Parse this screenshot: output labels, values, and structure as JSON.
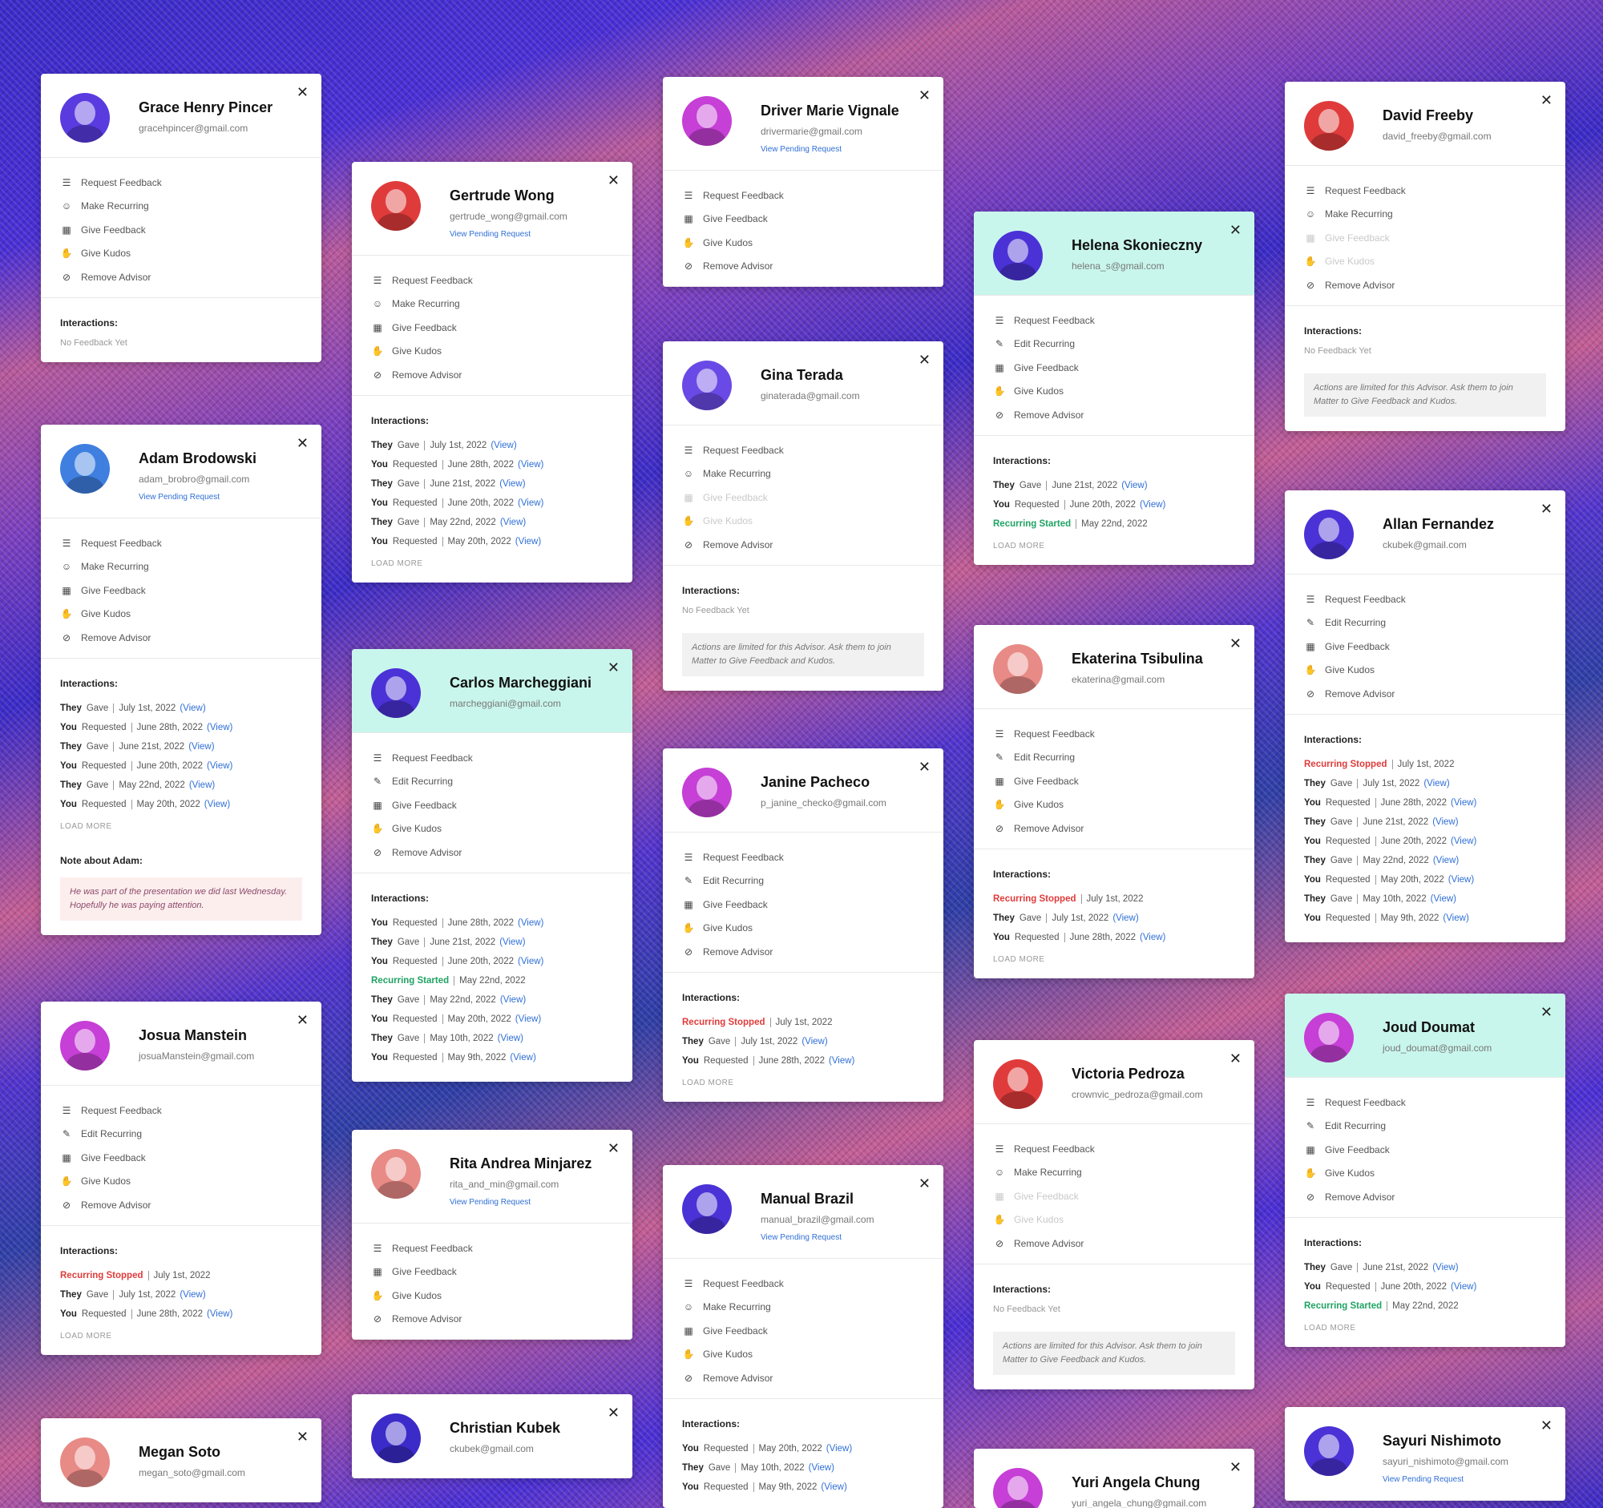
{
  "labels": {
    "request_feedback": "Request Feedback",
    "make_recurring": "Make Recurring",
    "edit_recurring": "Edit Recurring",
    "give_feedback": "Give Feedback",
    "give_kudos": "Give Kudos",
    "remove_advisor": "Remove Advisor",
    "interactions": "Interactions:",
    "no_feedback": "No Feedback Yet",
    "load_more": "LOAD MORE",
    "view_pending": "View Pending Request",
    "view": "(View)",
    "limited_notice": "Actions are limited for this Advisor. Ask them to join Matter to Give Feedback and Kudos.",
    "close": "✕"
  },
  "cards": [
    {
      "name": "Grace Henry Pincer",
      "email": "gracehpincer@gmail.com",
      "avatar_color": "#5a3be0",
      "highlight": false,
      "pending": false,
      "actions": [
        {
          "k": "request_feedback"
        },
        {
          "k": "make_recurring"
        },
        {
          "k": "give_feedback"
        },
        {
          "k": "give_kudos"
        },
        {
          "k": "remove_advisor"
        }
      ],
      "no_feedback": true,
      "interactions": [],
      "load_more": false,
      "notice": false
    },
    {
      "name": "Adam Brodowski",
      "email": "adam_brobro@gmail.com",
      "avatar_color": "#3f7fe0",
      "highlight": false,
      "pending": true,
      "actions": [
        {
          "k": "request_feedback"
        },
        {
          "k": "make_recurring"
        },
        {
          "k": "give_feedback"
        },
        {
          "k": "give_kudos"
        },
        {
          "k": "remove_advisor"
        }
      ],
      "no_feedback": false,
      "interactions": [
        {
          "who": "They",
          "what": "Gave",
          "date": "July 1st, 2022",
          "view": true
        },
        {
          "who": "You",
          "what": "Requested",
          "date": "June 28th, 2022",
          "view": true
        },
        {
          "who": "They",
          "what": "Gave",
          "date": "June 21st, 2022",
          "view": true
        },
        {
          "who": "You",
          "what": "Requested",
          "date": "June 20th, 2022",
          "view": true
        },
        {
          "who": "They",
          "what": "Gave",
          "date": "May 22nd, 2022",
          "view": true
        },
        {
          "who": "You",
          "what": "Requested",
          "date": "May 20th, 2022",
          "view": true
        }
      ],
      "load_more": true,
      "notice": false,
      "note_title": "Note about Adam:",
      "note": "He was part of the presentation we did last Wednesday. Hopefully he was paying attention."
    },
    {
      "name": "Josua Manstein",
      "email": "josuaManstein@gmail.com",
      "avatar_color": "#c63fd6",
      "highlight": false,
      "pending": false,
      "actions": [
        {
          "k": "request_feedback"
        },
        {
          "k": "edit_recurring"
        },
        {
          "k": "give_feedback"
        },
        {
          "k": "give_kudos"
        },
        {
          "k": "remove_advisor"
        }
      ],
      "no_feedback": false,
      "interactions": [
        {
          "status": "Recurring Stopped",
          "tone": "red",
          "date": "July 1st, 2022",
          "view": false
        },
        {
          "who": "They",
          "what": "Gave",
          "date": "July 1st, 2022",
          "view": true
        },
        {
          "who": "You",
          "what": "Requested",
          "date": "June 28th, 2022",
          "view": true
        }
      ],
      "load_more": true,
      "notice": false
    },
    {
      "name": "Megan Soto",
      "email": "megan_soto@gmail.com",
      "avatar_color": "#e88a86",
      "highlight": false,
      "pending": false,
      "actions": [],
      "no_feedback": false,
      "interactions": [],
      "load_more": false,
      "notice": false
    },
    {
      "name": "Gertrude Wong",
      "email": "gertrude_wong@gmail.com",
      "avatar_color": "#e03b3b",
      "highlight": false,
      "pending": true,
      "actions": [
        {
          "k": "request_feedback"
        },
        {
          "k": "make_recurring"
        },
        {
          "k": "give_feedback"
        },
        {
          "k": "give_kudos"
        },
        {
          "k": "remove_advisor"
        }
      ],
      "no_feedback": false,
      "interactions": [
        {
          "who": "They",
          "what": "Gave",
          "date": "July 1st, 2022",
          "view": true
        },
        {
          "who": "You",
          "what": "Requested",
          "date": "June 28th, 2022",
          "view": true
        },
        {
          "who": "They",
          "what": "Gave",
          "date": "June 21st, 2022",
          "view": true
        },
        {
          "who": "You",
          "what": "Requested",
          "date": "June 20th, 2022",
          "view": true
        },
        {
          "who": "They",
          "what": "Gave",
          "date": "May 22nd, 2022",
          "view": true
        },
        {
          "who": "You",
          "what": "Requested",
          "date": "May 20th, 2022",
          "view": true
        }
      ],
      "load_more": true,
      "notice": false
    },
    {
      "name": "Carlos Marcheggiani",
      "email": "marcheggiani@gmail.com",
      "avatar_color": "#4a32d6",
      "highlight": true,
      "pending": false,
      "actions": [
        {
          "k": "request_feedback"
        },
        {
          "k": "edit_recurring"
        },
        {
          "k": "give_feedback"
        },
        {
          "k": "give_kudos"
        },
        {
          "k": "remove_advisor"
        }
      ],
      "no_feedback": false,
      "interactions": [
        {
          "who": "You",
          "what": "Requested",
          "date": "June 28th, 2022",
          "view": true
        },
        {
          "who": "They",
          "what": "Gave",
          "date": "June 21st, 2022",
          "view": true
        },
        {
          "who": "You",
          "what": "Requested",
          "date": "June 20th, 2022",
          "view": true
        },
        {
          "status": "Recurring Started",
          "tone": "green",
          "date": "May 22nd, 2022",
          "view": false
        },
        {
          "who": "They",
          "what": "Gave",
          "date": "May 22nd, 2022",
          "view": true
        },
        {
          "who": "You",
          "what": "Requested",
          "date": "May 20th, 2022",
          "view": true
        },
        {
          "who": "They",
          "what": "Gave",
          "date": "May 10th, 2022",
          "view": true
        },
        {
          "who": "You",
          "what": "Requested",
          "date": "May 9th, 2022",
          "view": true
        }
      ],
      "load_more": false,
      "notice": false
    },
    {
      "name": "Rita Andrea Minjarez",
      "email": "rita_and_min@gmail.com",
      "avatar_color": "#e88a86",
      "highlight": false,
      "pending": true,
      "actions": [
        {
          "k": "request_feedback"
        },
        {
          "k": "give_feedback"
        },
        {
          "k": "give_kudos"
        },
        {
          "k": "remove_advisor"
        }
      ],
      "no_feedback": false,
      "interactions": [],
      "load_more": false,
      "notice": false,
      "no_inter": true
    },
    {
      "name": "Christian Kubek",
      "email": "ckubek@gmail.com",
      "avatar_color": "#3b2bc9",
      "highlight": false,
      "pending": false,
      "actions": [],
      "no_feedback": false,
      "interactions": [],
      "load_more": false,
      "notice": false
    },
    {
      "name": "Driver Marie Vignale",
      "email": "drivermarie@gmail.com",
      "avatar_color": "#c63fd6",
      "highlight": false,
      "pending": true,
      "actions": [
        {
          "k": "request_feedback"
        },
        {
          "k": "give_feedback"
        },
        {
          "k": "give_kudos"
        },
        {
          "k": "remove_advisor"
        }
      ],
      "no_feedback": false,
      "interactions": [],
      "load_more": false,
      "notice": false,
      "no_inter": true
    },
    {
      "name": "Gina Terada",
      "email": "ginaterada@gmail.com",
      "avatar_color": "#6a4ae6",
      "highlight": false,
      "pending": false,
      "actions": [
        {
          "k": "request_feedback"
        },
        {
          "k": "make_recurring"
        },
        {
          "k": "give_feedback",
          "d": true
        },
        {
          "k": "give_kudos",
          "d": true
        },
        {
          "k": "remove_advisor"
        }
      ],
      "no_feedback": true,
      "interactions": [],
      "load_more": false,
      "notice": true
    },
    {
      "name": "Janine Pacheco",
      "email": "p_janine_checko@gmail.com",
      "avatar_color": "#c63fd6",
      "highlight": false,
      "pending": false,
      "actions": [
        {
          "k": "request_feedback"
        },
        {
          "k": "edit_recurring"
        },
        {
          "k": "give_feedback"
        },
        {
          "k": "give_kudos"
        },
        {
          "k": "remove_advisor"
        }
      ],
      "no_feedback": false,
      "interactions": [
        {
          "status": "Recurring Stopped",
          "tone": "red",
          "date": "July 1st, 2022",
          "view": false
        },
        {
          "who": "They",
          "what": "Gave",
          "date": "July 1st, 2022",
          "view": true
        },
        {
          "who": "You",
          "what": "Requested",
          "date": "June 28th, 2022",
          "view": true
        }
      ],
      "load_more": true,
      "notice": false
    },
    {
      "name": "Manual Brazil",
      "email": "manual_brazil@gmail.com",
      "avatar_color": "#4a32d6",
      "highlight": false,
      "pending": true,
      "actions": [
        {
          "k": "request_feedback"
        },
        {
          "k": "make_recurring"
        },
        {
          "k": "give_feedback"
        },
        {
          "k": "give_kudos"
        },
        {
          "k": "remove_advisor"
        }
      ],
      "no_feedback": false,
      "interactions": [
        {
          "who": "You",
          "what": "Requested",
          "date": "May 20th, 2022",
          "view": true
        },
        {
          "who": "They",
          "what": "Gave",
          "date": "May 10th, 2022",
          "view": true
        },
        {
          "who": "You",
          "what": "Requested",
          "date": "May 9th, 2022",
          "view": true
        }
      ],
      "load_more": false,
      "notice": false
    },
    {
      "name": "Helena Skonieczny",
      "email": "helena_s@gmail.com",
      "avatar_color": "#4a32d6",
      "highlight": true,
      "pending": false,
      "actions": [
        {
          "k": "request_feedback"
        },
        {
          "k": "edit_recurring"
        },
        {
          "k": "give_feedback"
        },
        {
          "k": "give_kudos"
        },
        {
          "k": "remove_advisor"
        }
      ],
      "no_feedback": false,
      "interactions": [
        {
          "who": "They",
          "what": "Gave",
          "date": "June 21st, 2022",
          "view": true
        },
        {
          "who": "You",
          "what": "Requested",
          "date": "June 20th, 2022",
          "view": true
        },
        {
          "status": "Recurring Started",
          "tone": "green",
          "date": "May 22nd, 2022",
          "view": false
        }
      ],
      "load_more": true,
      "notice": false
    },
    {
      "name": "Ekaterina Tsibulina",
      "email": "ekaterina@gmail.com",
      "avatar_color": "#e88a86",
      "highlight": false,
      "pending": false,
      "actions": [
        {
          "k": "request_feedback"
        },
        {
          "k": "edit_recurring"
        },
        {
          "k": "give_feedback"
        },
        {
          "k": "give_kudos"
        },
        {
          "k": "remove_advisor"
        }
      ],
      "no_feedback": false,
      "interactions": [
        {
          "status": "Recurring Stopped",
          "tone": "red",
          "date": "July 1st, 2022",
          "view": false
        },
        {
          "who": "They",
          "what": "Gave",
          "date": "July 1st, 2022",
          "view": true
        },
        {
          "who": "You",
          "what": "Requested",
          "date": "June 28th, 2022",
          "view": true
        }
      ],
      "load_more": true,
      "notice": false
    },
    {
      "name": "Victoria Pedroza",
      "email": "crownvic_pedroza@gmail.com",
      "avatar_color": "#e03b3b",
      "highlight": false,
      "pending": false,
      "actions": [
        {
          "k": "request_feedback"
        },
        {
          "k": "make_recurring"
        },
        {
          "k": "give_feedback",
          "d": true
        },
        {
          "k": "give_kudos",
          "d": true
        },
        {
          "k": "remove_advisor"
        }
      ],
      "no_feedback": true,
      "interactions": [],
      "load_more": false,
      "notice": true
    },
    {
      "name": "Yuri Angela Chung",
      "email": "yuri_angela_chung@gmail.com",
      "avatar_color": "#c63fd6",
      "highlight": false,
      "pending": false,
      "actions": [],
      "no_feedback": false,
      "interactions": [],
      "load_more": false,
      "notice": false
    },
    {
      "name": "David Freeby",
      "email": "david_freeby@gmail.com",
      "avatar_color": "#e03b3b",
      "highlight": false,
      "pending": false,
      "actions": [
        {
          "k": "request_feedback"
        },
        {
          "k": "make_recurring"
        },
        {
          "k": "give_feedback",
          "d": true
        },
        {
          "k": "give_kudos",
          "d": true
        },
        {
          "k": "remove_advisor"
        }
      ],
      "no_feedback": true,
      "interactions": [],
      "load_more": false,
      "notice": true
    },
    {
      "name": "Allan Fernandez",
      "email": "ckubek@gmail.com",
      "avatar_color": "#4a32d6",
      "highlight": false,
      "pending": false,
      "actions": [
        {
          "k": "request_feedback"
        },
        {
          "k": "edit_recurring"
        },
        {
          "k": "give_feedback"
        },
        {
          "k": "give_kudos"
        },
        {
          "k": "remove_advisor"
        }
      ],
      "no_feedback": false,
      "interactions": [
        {
          "status": "Recurring Stopped",
          "tone": "red",
          "date": "July 1st, 2022",
          "view": false
        },
        {
          "who": "They",
          "what": "Gave",
          "date": "July 1st, 2022",
          "view": true
        },
        {
          "who": "You",
          "what": "Requested",
          "date": "June 28th, 2022",
          "view": true
        },
        {
          "who": "They",
          "what": "Gave",
          "date": "June 21st, 2022",
          "view": true
        },
        {
          "who": "You",
          "what": "Requested",
          "date": "June 20th, 2022",
          "view": true
        },
        {
          "who": "They",
          "what": "Gave",
          "date": "May 22nd, 2022",
          "view": true
        },
        {
          "who": "You",
          "what": "Requested",
          "date": "May 20th, 2022",
          "view": true
        },
        {
          "who": "They",
          "what": "Gave",
          "date": "May 10th, 2022",
          "view": true
        },
        {
          "who": "You",
          "what": "Requested",
          "date": "May 9th, 2022",
          "view": true
        }
      ],
      "load_more": false,
      "notice": false
    },
    {
      "name": "Joud Doumat",
      "email": "joud_doumat@gmail.com",
      "avatar_color": "#c63fd6",
      "highlight": true,
      "pending": false,
      "actions": [
        {
          "k": "request_feedback"
        },
        {
          "k": "edit_recurring"
        },
        {
          "k": "give_feedback"
        },
        {
          "k": "give_kudos"
        },
        {
          "k": "remove_advisor"
        }
      ],
      "no_feedback": false,
      "interactions": [
        {
          "who": "They",
          "what": "Gave",
          "date": "June 21st, 2022",
          "view": true
        },
        {
          "who": "You",
          "what": "Requested",
          "date": "June 20th, 2022",
          "view": true
        },
        {
          "status": "Recurring Started",
          "tone": "green",
          "date": "May 22nd, 2022",
          "view": false
        }
      ],
      "load_more": true,
      "notice": false
    },
    {
      "name": "Sayuri Nishimoto",
      "email": "sayuri_nishimoto@gmail.com",
      "avatar_color": "#4a32d6",
      "highlight": false,
      "pending": true,
      "actions": [],
      "no_feedback": false,
      "interactions": [],
      "load_more": false,
      "notice": false
    }
  ]
}
